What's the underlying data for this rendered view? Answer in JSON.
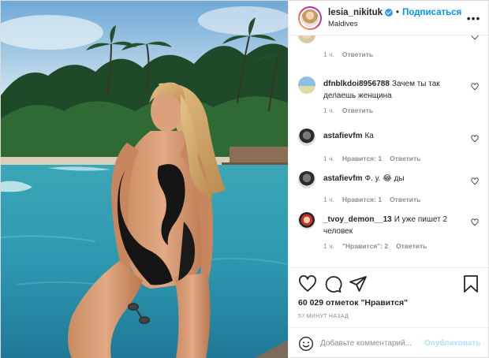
{
  "header": {
    "username": "lesia_nikituk",
    "separator": "•",
    "follow_label": "Подписаться",
    "location": "Maldives",
    "more_icon": "more-horizontal-icon"
  },
  "comments": [
    {
      "user": "",
      "text": "",
      "time": "1 ч.",
      "likes": "",
      "reply": "Ответить",
      "avatar_color": "#e8e2d0"
    },
    {
      "user": "dfnblkdoi8956788",
      "text": "Зачем ты так делаешь женщина",
      "time": "1 ч.",
      "likes": "",
      "reply": "Ответить",
      "avatar_color": "#87b6d6"
    },
    {
      "user": "astafievfm",
      "text": "Ка",
      "time": "1 ч.",
      "likes": "Нравится: 1",
      "reply": "Ответить",
      "avatar_color": "#3a3a3a"
    },
    {
      "user": "astafievfm",
      "text": "Ф. у. 😂 ды",
      "time": "1 ч.",
      "likes": "Нравится: 1",
      "reply": "Ответить",
      "avatar_color": "#3a3a3a"
    },
    {
      "user": "_tvoy_demon__13",
      "text": "И уже пишет 2 человек",
      "time": "1 ч.",
      "likes": "\"Нравится\": 2",
      "reply": "Ответить",
      "avatar_color": "#c9302c"
    }
  ],
  "actions": {
    "icons": [
      "heart-icon",
      "comment-icon",
      "share-icon",
      "bookmark-icon"
    ],
    "likes_text": "60 029 отметок \"Нравится\"",
    "timestamp": "57 минут назад"
  },
  "add_comment": {
    "placeholder": "Добавьте комментарий...",
    "publish_label": "Опубликовать"
  },
  "colors": {
    "accent": "#0095f6",
    "verified": "#3897f0",
    "muted": "#8e8e8e",
    "publish_disabled": "#b2dffc"
  }
}
